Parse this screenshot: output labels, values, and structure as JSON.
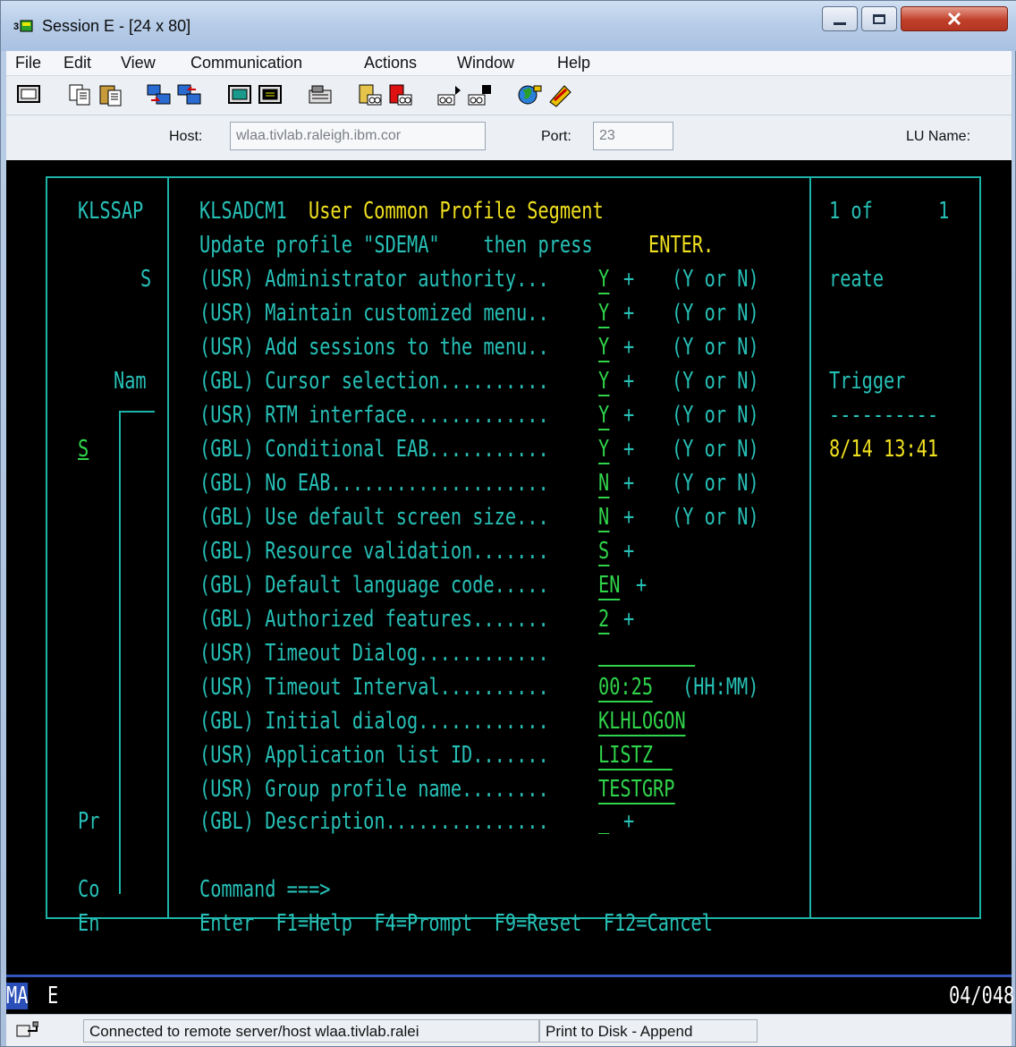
{
  "window": {
    "title": "Session E - [24 x 80]"
  },
  "menu": [
    "File",
    "Edit",
    "View",
    "Communication",
    "Actions",
    "Window",
    "Help"
  ],
  "toolbar_icons": [
    "screen-icon",
    "copy-icon",
    "paste-icon",
    "send-icon",
    "receive-icon",
    "display-icon",
    "display2-icon",
    "keyboard-icon",
    "macro-record-icon",
    "macro-stop-icon",
    "macro-play-icon",
    "macro-save-icon",
    "globe-icon",
    "help-icon"
  ],
  "hostbar": {
    "host_label": "Host:",
    "host_value": "wlaa.tivlab.raleigh.ibm.cor",
    "port_label": "Port:",
    "port_value": "23",
    "lu_label": "LU Name:"
  },
  "terminal": {
    "background_left": {
      "klssap": "KLSSAP",
      "s": "S",
      "nam": "Nam",
      "s_sel": "S",
      "pr": "Pr",
      "co": "Co",
      "en": "En"
    },
    "background_right": {
      "page": "1 of      1",
      "reate": "reate",
      "trigger": "Trigger",
      "dashes": "----------",
      "time": "8/14 13:41"
    },
    "dialog": {
      "title_id": "KLSADCM1",
      "title": "User Common Profile Segment",
      "instr_prefix": "Update profile \"SDEMA\"    then press",
      "instr_key": "ENTER.",
      "rows": [
        {
          "label": "(USR) Administrator authority...",
          "value": "Y",
          "plus": "+",
          "hint": "(Y or N)"
        },
        {
          "label": "(USR) Maintain customized menu..",
          "value": "Y",
          "plus": "+",
          "hint": "(Y or N)"
        },
        {
          "label": "(USR) Add sessions to the menu..",
          "value": "Y",
          "plus": "+",
          "hint": "(Y or N)"
        },
        {
          "label": "(GBL) Cursor selection..........",
          "value": "Y",
          "plus": "+",
          "hint": "(Y or N)"
        },
        {
          "label": "(USR) RTM interface.............",
          "value": "Y",
          "plus": "+",
          "hint": "(Y or N)"
        },
        {
          "label": "(GBL) Conditional EAB...........",
          "value": "Y",
          "plus": "+",
          "hint": "(Y or N)"
        },
        {
          "label": "(GBL) No EAB....................",
          "value": "N",
          "plus": "+",
          "hint": "(Y or N)"
        },
        {
          "label": "(GBL) Use default screen size...",
          "value": "N",
          "plus": "+",
          "hint": "(Y or N)"
        },
        {
          "label": "(GBL) Resource validation.......",
          "value": "S",
          "plus": "+",
          "hint": ""
        },
        {
          "label": "(GBL) Default language code.....",
          "value": "EN",
          "plus": "+",
          "hint": ""
        },
        {
          "label": "(GBL) Authorized features.......",
          "value": "2",
          "plus": "+",
          "hint": ""
        },
        {
          "label": "(USR) Timeout Dialog............",
          "value": "",
          "plus": "",
          "hint": ""
        },
        {
          "label": "(USR) Timeout Interval..........",
          "value": "00:25",
          "plus": "",
          "hint": "(HH:MM)"
        },
        {
          "label": "(GBL) Initial dialog............",
          "value": "KLHLOGON",
          "plus": "",
          "hint": ""
        },
        {
          "label": "(USR) Application list ID.......",
          "value": "LISTZ",
          "plus": "",
          "hint": ""
        },
        {
          "label": "(USR) Group profile name........",
          "value": "TESTGRP",
          "plus": "",
          "hint": ""
        },
        {
          "label": "(GBL) Description...............",
          "value": "_",
          "plus": "+",
          "hint": ""
        }
      ],
      "command_label": "Command ===>",
      "fkeys": "Enter  F1=Help  F4=Prompt  F9=Reset  F12=Cancel"
    }
  },
  "oia": {
    "ma": "MA",
    "e": "E",
    "cursor_pos": "04/048"
  },
  "status": {
    "connection": "Connected to remote server/host wlaa.tivlab.ralei",
    "print": "Print to Disk - Append"
  },
  "colors": {
    "cyan": "#27c0b6",
    "yellow": "#f0e020",
    "green": "#30d44a",
    "border": "#1db3a8"
  }
}
